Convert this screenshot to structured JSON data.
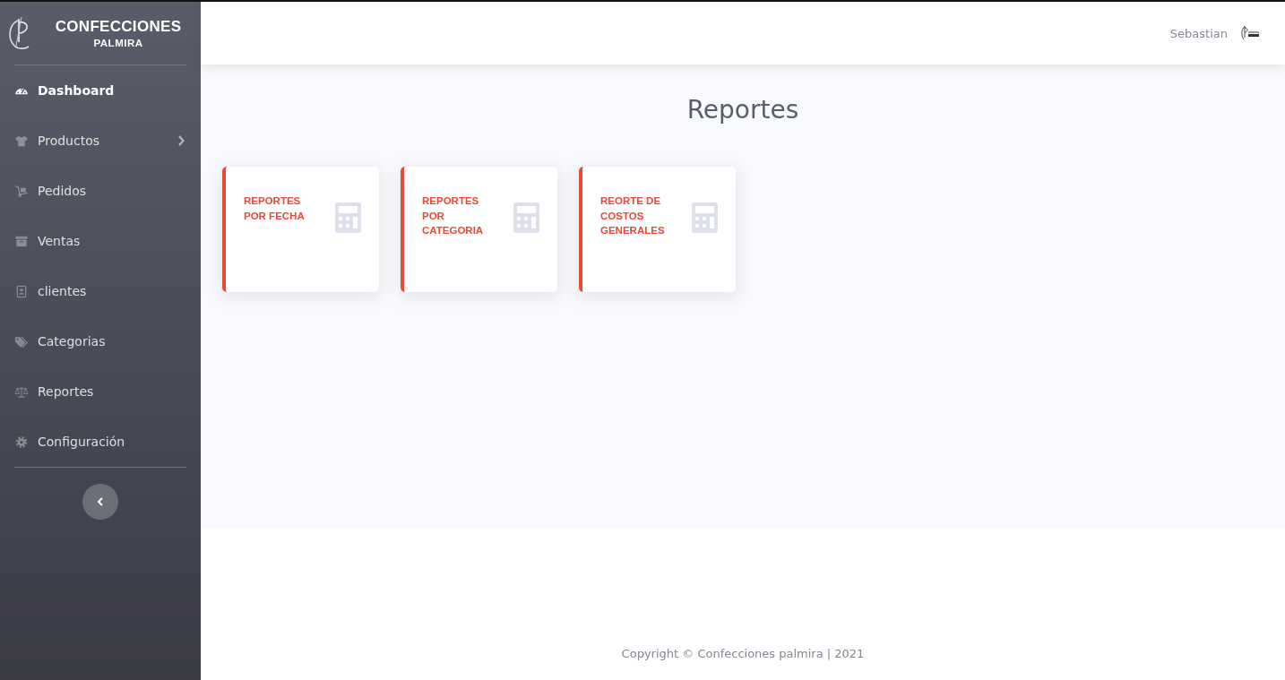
{
  "brand": {
    "title": "CONFECCIONES",
    "subtitle": "PALMIRA"
  },
  "sidebar": {
    "items": [
      {
        "label": "Dashboard",
        "kind": "gauge",
        "selected": true,
        "has_submenu": false
      },
      {
        "label": "Productos",
        "kind": "shirt",
        "selected": false,
        "has_submenu": true
      },
      {
        "label": "Pedidos",
        "kind": "dolly",
        "selected": false,
        "has_submenu": false
      },
      {
        "label": "Ventas",
        "kind": "archive",
        "selected": false,
        "has_submenu": false
      },
      {
        "label": "clientes",
        "kind": "contact",
        "selected": false,
        "has_submenu": false
      },
      {
        "label": "Categorias",
        "kind": "tags",
        "selected": false,
        "has_submenu": false
      },
      {
        "label": "Reportes",
        "kind": "scale",
        "selected": false,
        "has_submenu": false
      },
      {
        "label": "Configuración",
        "kind": "gear",
        "selected": false,
        "has_submenu": false
      }
    ]
  },
  "header": {
    "user": "Sebastian"
  },
  "page": {
    "title": "Reportes",
    "cards": [
      {
        "label": "REPORTES POR FECHA"
      },
      {
        "label": "REPORTES POR CATEGORIA"
      },
      {
        "label": "REORTE DE COSTOS GENERALES"
      }
    ]
  },
  "footer": {
    "text": "Copyright © Confecciones palmira | 2021"
  }
}
